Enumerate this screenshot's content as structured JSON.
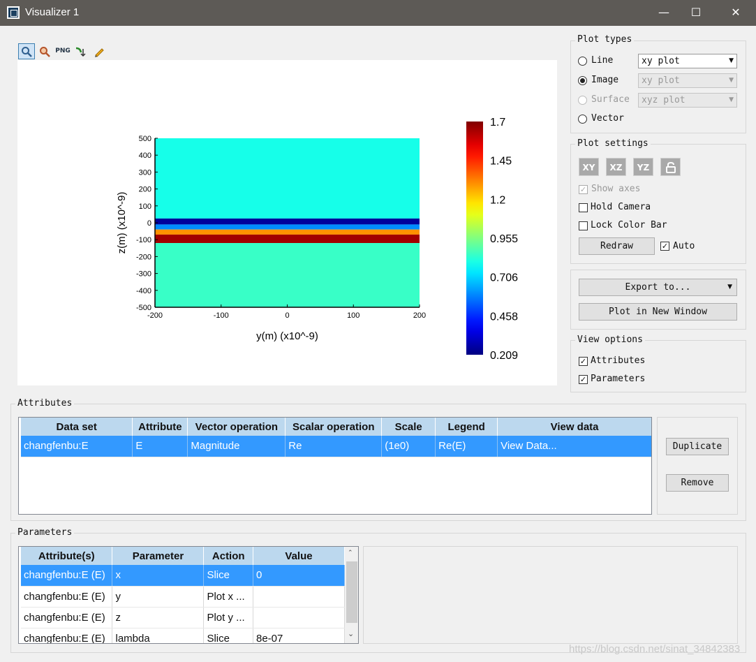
{
  "window": {
    "title": "Visualizer 1",
    "controls": {
      "minimize": "—",
      "maximize": "☐",
      "close": "✕"
    }
  },
  "toolbar": [
    {
      "name": "zoom-icon",
      "glyph": "🔍"
    },
    {
      "name": "zoom-region-icon",
      "glyph": "🔎"
    },
    {
      "name": "png-export-icon",
      "glyph": "PNG"
    },
    {
      "name": "data-cursor-icon",
      "glyph": "↘"
    },
    {
      "name": "pencil-icon",
      "glyph": "✏"
    }
  ],
  "chart_data": {
    "type": "heatmap",
    "xlabel": "y(m) (x10^-9)",
    "ylabel": "z(m) (x10^-9)",
    "xlim": [
      -200,
      200
    ],
    "ylim": [
      -500,
      500
    ],
    "xticks": [
      "-200",
      "-100",
      "0",
      "100",
      "200"
    ],
    "yticks": [
      "500",
      "400",
      "300",
      "200",
      "100",
      "0",
      "-100",
      "-200",
      "-300",
      "-400",
      "-500"
    ],
    "bands": [
      {
        "z_from": 500,
        "z_to": 25,
        "value": 0.8
      },
      {
        "z_from": 25,
        "z_to": -10,
        "value": 0.25
      },
      {
        "z_from": -10,
        "z_to": -40,
        "value": 0.6
      },
      {
        "z_from": -40,
        "z_to": -70,
        "value": 1.3
      },
      {
        "z_from": -70,
        "z_to": -120,
        "value": 1.65
      },
      {
        "z_from": -120,
        "z_to": -500,
        "value": 0.85
      }
    ],
    "colorbar": {
      "min": 0.209,
      "max": 1.7,
      "labels": [
        "1.7",
        "1.45",
        "1.2",
        "0.955",
        "0.706",
        "0.458",
        "0.209"
      ],
      "colormap": "jet"
    }
  },
  "plot_types": {
    "label": "Plot types",
    "options": [
      {
        "label": "Line",
        "selected": false,
        "enabled": true,
        "combo": "xy plot"
      },
      {
        "label": "Image",
        "selected": true,
        "enabled": true,
        "combo": "xy plot"
      },
      {
        "label": "Surface",
        "selected": false,
        "enabled": false,
        "combo": "xyz plot"
      },
      {
        "label": "Vector",
        "selected": false,
        "enabled": true,
        "combo": ""
      }
    ]
  },
  "plot_settings": {
    "label": "Plot settings",
    "view_buttons": [
      "XY",
      "XZ",
      "YZ"
    ],
    "show_axes": "Show axes",
    "hold_camera": "Hold Camera",
    "lock_color_bar": "Lock Color Bar",
    "redraw": "Redraw",
    "auto": "Auto"
  },
  "export": {
    "export_to": "Export to...",
    "plot_new_window": "Plot in New Window"
  },
  "view_options": {
    "label": "View options",
    "attributes": "Attributes",
    "parameters": "Parameters"
  },
  "attributes": {
    "label": "Attributes",
    "headers": [
      "Data set",
      "Attribute",
      "Vector operation",
      "Scalar operation",
      "Scale",
      "Legend",
      "View data"
    ],
    "rows": [
      [
        "changfenbu:E",
        "E",
        "Magnitude",
        "Re",
        "(1e0)",
        "Re(E)",
        "View Data..."
      ]
    ],
    "duplicate": "Duplicate",
    "remove": "Remove"
  },
  "parameters": {
    "label": "Parameters",
    "headers": [
      "Attribute(s)",
      "Parameter",
      "Action",
      "Value"
    ],
    "rows": [
      [
        "changfenbu:E (E)",
        "x",
        "Slice",
        "0"
      ],
      [
        "changfenbu:E (E)",
        "y",
        "Plot x ...",
        ""
      ],
      [
        "changfenbu:E (E)",
        "z",
        "Plot y ...",
        ""
      ],
      [
        "changfenbu:E (E)",
        "lambda",
        "Slice",
        "8e-07"
      ]
    ]
  },
  "watermark": "https://blog.csdn.net/sinat_34842383",
  "colors": {
    "selection": "#3399ff",
    "header": "#bcd8ee",
    "titlebar": "#5d5a56"
  }
}
